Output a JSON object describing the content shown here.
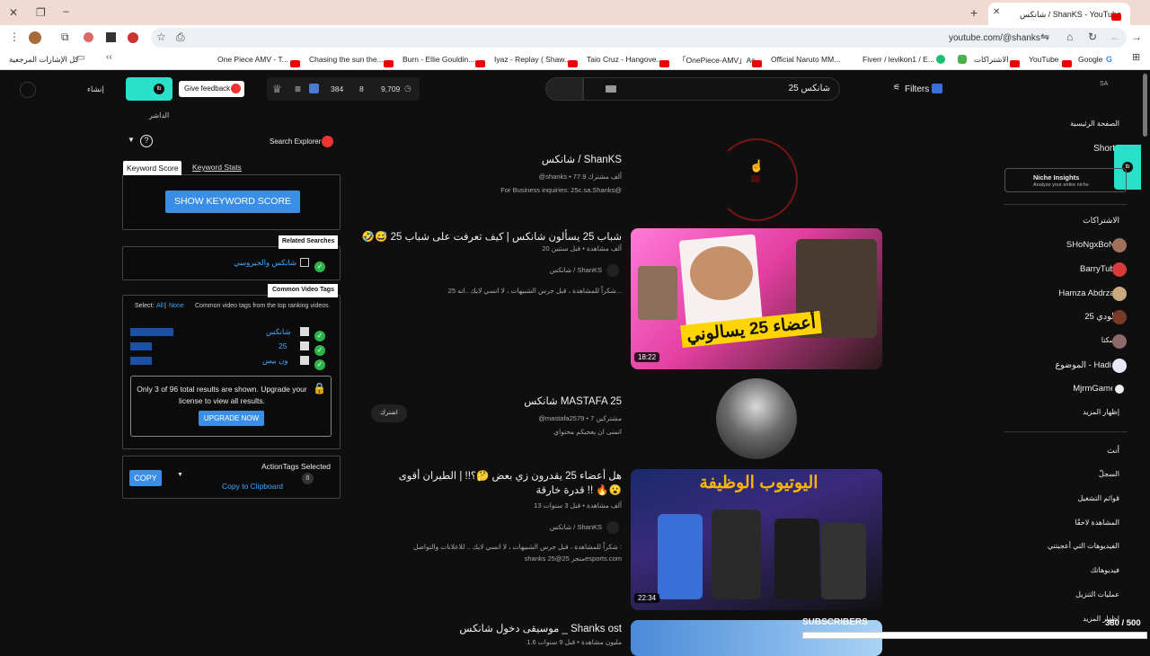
{
  "browser": {
    "tab_title": "شانكس / ShanKS - YouTube",
    "url": "youtube.com/@shanks",
    "bookmarks": [
      {
        "label": "كل الإشارات المرجعية"
      },
      {
        "label": "One Piece AMV - T..."
      },
      {
        "label": "Chasing the sun the..."
      },
      {
        "label": "Burn - Ellie Gouldin..."
      },
      {
        "label": "Iyaz - Replay ( Shaw..."
      },
      {
        "label": "Taio Cruz - Hangove..."
      },
      {
        "label": "「OnePiece-AMV」Ac..."
      },
      {
        "label": "Official Naruto MM..."
      },
      {
        "label": "Fiverr / levikon1 / E..."
      },
      {
        "label": "الاشتراكات"
      },
      {
        "label": "YouTube"
      },
      {
        "label": "Google"
      }
    ]
  },
  "toolbar": {
    "create_label": "إنشاء",
    "feedback_label": "Give feedback",
    "stat1": "384",
    "stat2": "8",
    "stat3": "9,709",
    "search_value": "شانكس 25",
    "filters_label": "Filters",
    "country": "SA",
    "explore_label": "الداشر"
  },
  "ext": {
    "search_explorer": "Search Explorer",
    "tab_score": "Keyword Score",
    "tab_stats": "Keyword Stats",
    "show_score": "SHOW KEYWORD SCORE",
    "related_title": "Related Searches",
    "related_item": "شانكس والجيروسي",
    "tags_title": "Common Video Tags",
    "select_label": "Select:",
    "select_all": "All",
    "select_none": "None",
    "tags_desc": "Common video tags from the top ranking videos",
    "tags": [
      "شانكس",
      "25",
      "ون بيس"
    ],
    "upgrade_text": "Only 3 of 96 total results are shown. Upgrade your license to view all results.",
    "upgrade_btn": "UPGRADE NOW",
    "action_title": "ActionTags Selected",
    "action_count": "0",
    "copy_btn": "COPY",
    "copy_clip": "Copy to Clipboard"
  },
  "results": {
    "channel1": {
      "name": "شانكس / ShanKS",
      "meta": "‎@shanks • 77.9 ألف مشترك",
      "desc": "For Business inquiries: 25c.sa.Shanks@"
    },
    "video1": {
      "title": "🤣😅 شباب 25 يسألون شانكس | كيف تعرفت على شباب 25",
      "meta": "20 ألف مشاهدة • قبل سنتين",
      "channel": "شانكس / ShanKS",
      "desc": "شكراً للمشاهدة ، قبل جرس الشبيهات ، لا انسي لايك ..انه 25...",
      "duration": "18:22",
      "thumb_text": "أعضاء 25 يسالوني"
    },
    "channel2": {
      "name": "شانكس MASTAFA 25",
      "meta": "‎@mastafa2579 • 7 مشتركين",
      "desc": "اتمنى ان يعجبكم محتواي",
      "join": "اشترك"
    },
    "video2": {
      "title": "هل أعضاء 25 يقدرون زي بعض 🤔؟!! | الطيران أقوى قدرة خارقة !! 🔥😮",
      "meta": "13 ألف مشاهدة • قبل 3 سنوات",
      "channel": "شانكس / ShanKS",
      "desc": "شكراً للمشاهدة ، قبل جرس الشبيهات ، لا انسي لايك .. للاعلانات والتواصل :",
      "desc2": "shanks متجر 25@25esports.com",
      "duration": "22:34",
      "thumb_text": "اليوتيوب الوظيفة"
    },
    "video3": {
      "title": "موسيقى دخول شانكس _ Shanks ost",
      "meta": "1.6 مليون مشاهدة • قبل 9 سنوات",
      "overlay": "SUBSCRIBERS",
      "counter": "380 / 500"
    }
  },
  "sidebar": {
    "home": "الصفحة الرئيسية",
    "shorts": "Shorts",
    "niche_title": "Niche Insights",
    "niche_sub": "Analyze your entire niche",
    "subs_header": "الاشتراكات",
    "subs": [
      "SHoNgxBoNg",
      "BarryTube",
      "Hamza Abdrzaq",
      "خلودي 25",
      "كسكتا",
      "الموضوع - Hadi X",
      "MjrmGames"
    ],
    "show_more": "إظهار المزيد",
    "you_header": "أنت",
    "you_items": [
      "السجلّ",
      "قوائم التشغيل",
      "المشاهدة لاحقًا",
      "الفيديوهات التي أعجبتني",
      "فيديوهاتك",
      "عمليات التنزيل",
      "إظهار المزيد"
    ]
  },
  "colors": {
    "accent": "#3ea6ff",
    "teal": "#29e0c8",
    "yt_red": "#ff0000"
  }
}
